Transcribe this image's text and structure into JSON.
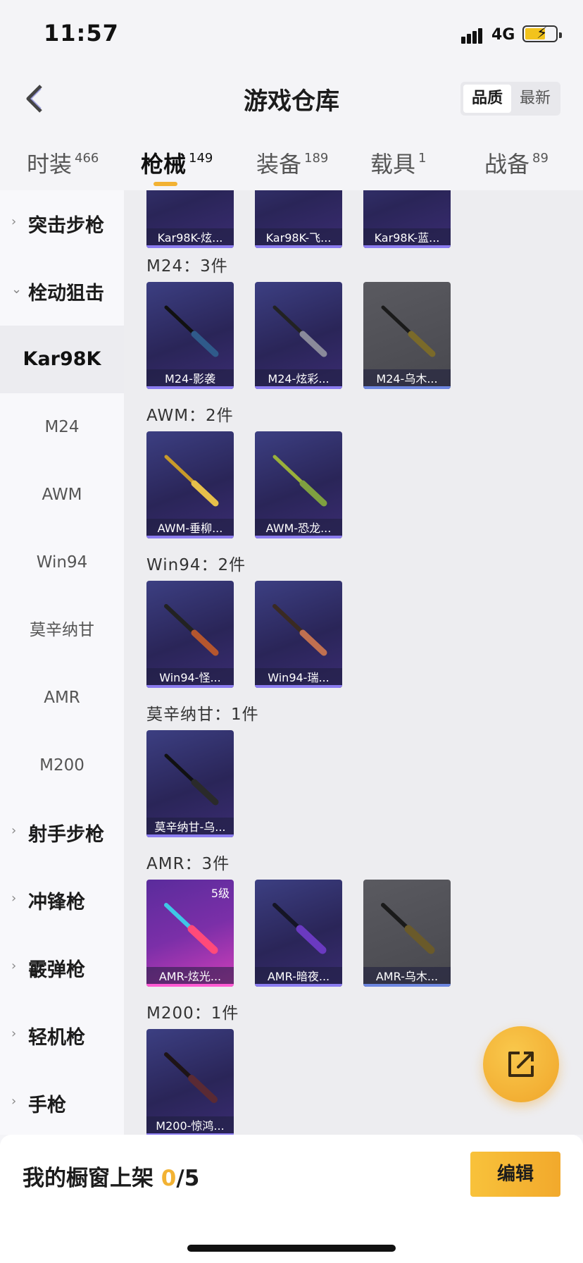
{
  "status": {
    "time": "11:57",
    "network": "4G"
  },
  "header": {
    "title": "游戏仓库",
    "sort_options": [
      "品质",
      "最新"
    ]
  },
  "tabs": [
    {
      "label": "时装",
      "count": "466"
    },
    {
      "label": "枪械",
      "count": "149"
    },
    {
      "label": "装备",
      "count": "189"
    },
    {
      "label": "载具",
      "count": "1"
    },
    {
      "label": "战备",
      "count": "89"
    }
  ],
  "sidebar": {
    "categories": [
      "突击步枪",
      "栓动狙击",
      "射手步枪",
      "冲锋枪",
      "霰弹枪",
      "轻机枪",
      "手枪"
    ],
    "subitems": [
      "Kar98K",
      "M24",
      "AWM",
      "Win94",
      "莫辛纳甘",
      "AMR",
      "M200"
    ]
  },
  "groups": [
    {
      "items": [
        {
          "label": "Kar98K-炫..."
        },
        {
          "label": "Kar98K-飞..."
        },
        {
          "label": "Kar98K-蓝..."
        }
      ]
    },
    {
      "title": "M24：3件",
      "items": [
        {
          "label": "M24-影袭"
        },
        {
          "label": "M24-炫彩..."
        },
        {
          "label": "M24-乌木..."
        }
      ]
    },
    {
      "title": "AWM：2件",
      "items": [
        {
          "label": "AWM-垂柳..."
        },
        {
          "label": "AWM-恐龙..."
        }
      ]
    },
    {
      "title": "Win94：2件",
      "items": [
        {
          "label": "Win94-怪..."
        },
        {
          "label": "Win94-瑞..."
        }
      ]
    },
    {
      "title": "莫辛纳甘：1件",
      "items": [
        {
          "label": "莫辛纳甘-乌..."
        }
      ]
    },
    {
      "title": "AMR：3件",
      "items": [
        {
          "label": "AMR-炫光...",
          "level": "5级"
        },
        {
          "label": "AMR-暗夜..."
        },
        {
          "label": "AMR-乌木..."
        }
      ]
    },
    {
      "title": "M200：1件",
      "items": [
        {
          "label": "M200-惊鸿..."
        }
      ]
    }
  ],
  "bottom": {
    "showcase_label": "我的橱窗上架",
    "showcase_used": "0",
    "showcase_total": "/5",
    "edit_label": "编辑"
  },
  "colors": {
    "accent": "#f2b233",
    "card_purple": "#2a2558",
    "card_grey": "#4c4c52",
    "card_pink": "#d23fb9"
  },
  "icons": {
    "back": "chevron-left-icon",
    "share": "share-external-icon"
  }
}
